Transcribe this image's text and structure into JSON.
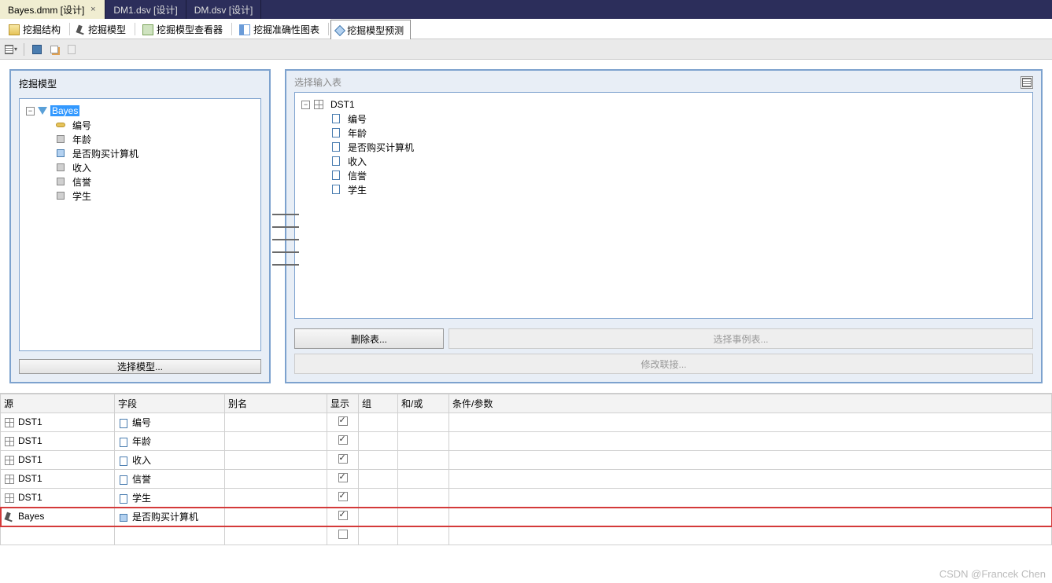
{
  "doc_tabs": [
    {
      "label": "Bayes.dmm [设计]",
      "active": true
    },
    {
      "label": "DM1.dsv [设计]",
      "active": false
    },
    {
      "label": "DM.dsv [设计]",
      "active": false
    }
  ],
  "mining_tabs": [
    {
      "label": "挖掘结构",
      "icon": "struct"
    },
    {
      "label": "挖掘模型",
      "icon": "model"
    },
    {
      "label": "挖掘模型查看器",
      "icon": "viewer"
    },
    {
      "label": "挖掘准确性图表",
      "icon": "chart"
    },
    {
      "label": "挖掘模型预测",
      "icon": "pred",
      "active": true
    }
  ],
  "left_panel": {
    "title": "挖掘模型",
    "root": "Bayes",
    "children": [
      "编号",
      "年龄",
      "是否购买计算机",
      "收入",
      "信誉",
      "学生"
    ],
    "button": "选择模型..."
  },
  "right_panel": {
    "title": "选择输入表",
    "root": "DST1",
    "children": [
      "编号",
      "年龄",
      "是否购买计算机",
      "收入",
      "信誉",
      "学生"
    ],
    "btn_delete": "删除表...",
    "btn_select_case": "选择事例表...",
    "btn_modify_join": "修改联接..."
  },
  "grid": {
    "headers": {
      "source": "源",
      "field": "字段",
      "alias": "别名",
      "show": "显示",
      "group": "组",
      "andor": "和/或",
      "cond": "条件/参数"
    },
    "rows": [
      {
        "src_icon": "table",
        "source": "DST1",
        "field_icon": "col",
        "field": "编号",
        "show": true
      },
      {
        "src_icon": "table",
        "source": "DST1",
        "field_icon": "col",
        "field": "年龄",
        "show": true
      },
      {
        "src_icon": "table",
        "source": "DST1",
        "field_icon": "col",
        "field": "收入",
        "show": true
      },
      {
        "src_icon": "table",
        "source": "DST1",
        "field_icon": "col",
        "field": "信誉",
        "show": true
      },
      {
        "src_icon": "table",
        "source": "DST1",
        "field_icon": "col",
        "field": "学生",
        "show": true
      },
      {
        "src_icon": "model",
        "source": "Bayes",
        "field_icon": "pred-field",
        "field": "是否购买计算机",
        "show": true,
        "highlight": true
      }
    ]
  },
  "watermark": "CSDN @Francek Chen"
}
